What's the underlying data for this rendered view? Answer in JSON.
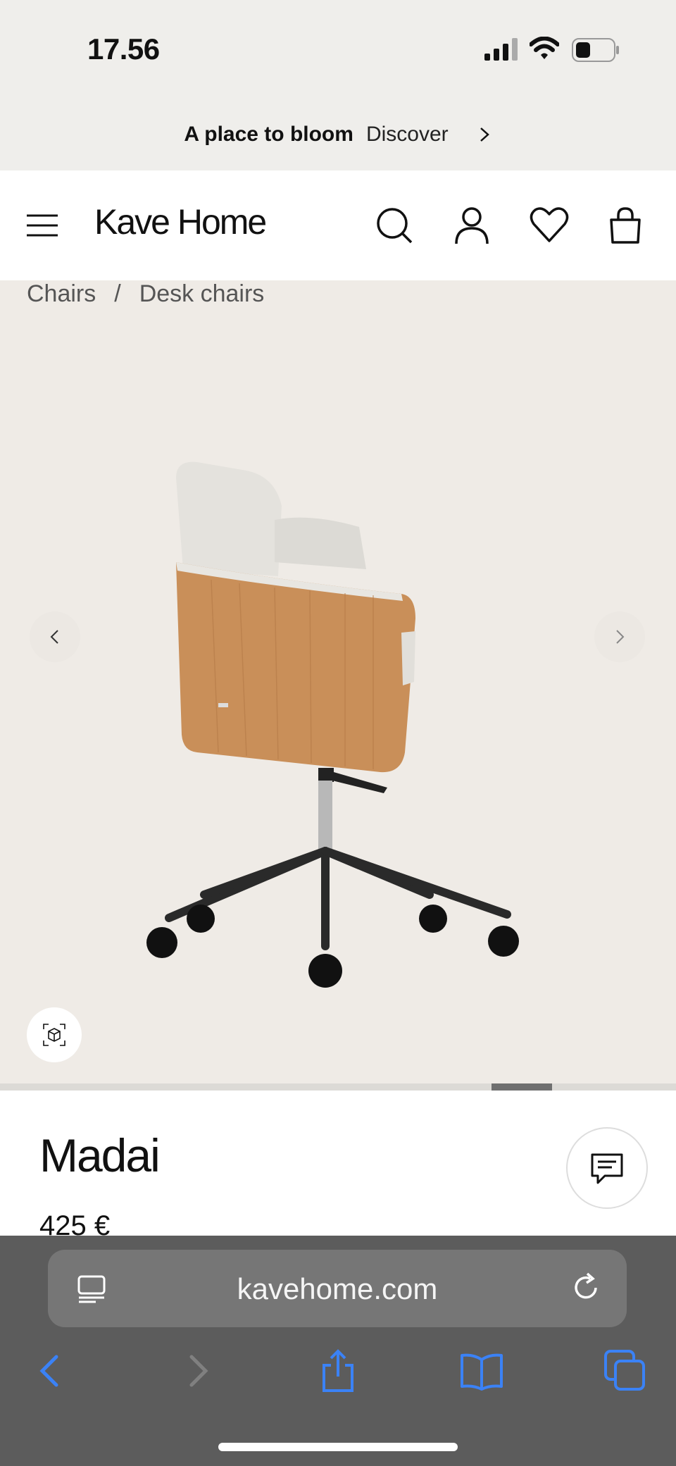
{
  "status_bar": {
    "time": "17.56"
  },
  "promo": {
    "title": "A place to bloom",
    "link": "Discover"
  },
  "header": {
    "brand": "Kave Home"
  },
  "breadcrumb": {
    "items": [
      "Chairs",
      "Desk chairs"
    ],
    "separator": "/"
  },
  "gallery": {
    "current_slide_fraction_start": 0.727,
    "current_slide_fraction_end": 0.817
  },
  "product": {
    "name": "Madai",
    "price": "425 €"
  },
  "browser": {
    "url": "kavehome.com",
    "accent": "#3b82f6"
  },
  "colors": {
    "page_bg": "#efebe6",
    "chrome_bg": "#5c5c5c",
    "wood": "#c8905a",
    "fabric": "#e6e4df"
  }
}
